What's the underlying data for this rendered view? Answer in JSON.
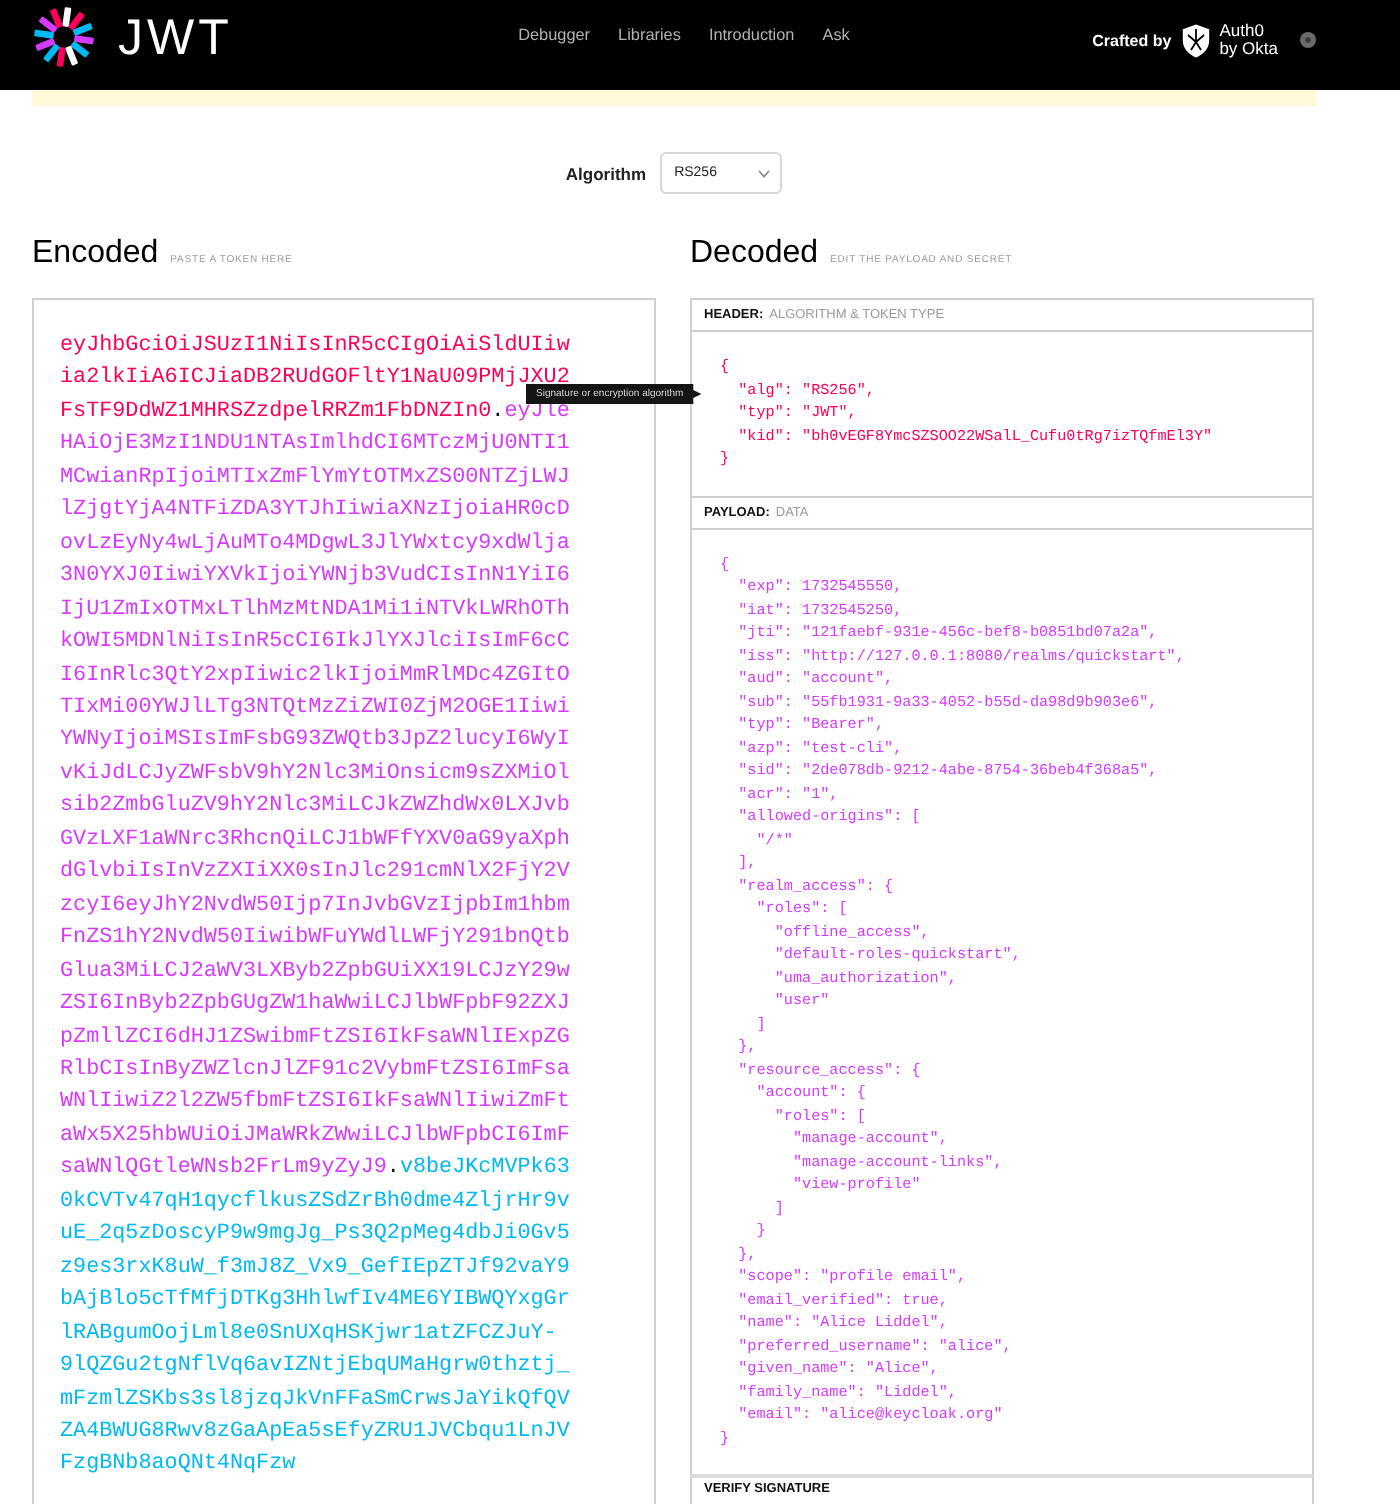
{
  "nav": {
    "logo_text": "JWT",
    "links": [
      "Debugger",
      "Libraries",
      "Introduction",
      "Ask"
    ],
    "credit_label": "Crafted by",
    "credit_brand": [
      "Auth0",
      "by Okta"
    ]
  },
  "algorithm": {
    "label": "Algorithm",
    "value": "RS256"
  },
  "tooltip": "Signature or encryption algorithm",
  "encoded": {
    "title": "Encoded",
    "hint": "PASTE A TOKEN HERE",
    "token_parts": [
      {
        "kind": "header",
        "text": "eyJhbGciOiJSUzI1NiIsInR5cCIgOiAiSldUIiwia2lkIiA6ICJiaDB2RUdGOFltY1NaU09PMjJXU2FsTF9DdWZ1MHRSZzdpelRRZm1FbDNZIn0"
      },
      {
        "kind": "separator",
        "text": "."
      },
      {
        "kind": "payload",
        "text": "eyJleHAiOjE3MzI1NDU1NTAsImlhdCI6MTczMjU0NTI1MCwianRpIjoiMTIxZmFlYmYtOTMxZS00NTZjLWJlZjgtYjA4NTFiZDA3YTJhIiwiaXNzIjoiaHR0cDovLzEyNy4wLjAuMTo4MDgwL3JlYWxtcy9xdWlja3N0YXJ0IiwiYXVkIjoiYWNjb3VudCIsInN1YiI6IjU1ZmIxOTMxLTlhMzMtNDA1Mi1iNTVkLWRhOThkOWI5MDNlNiIsInR5cCI6IkJlYXJlciIsImF6cCI6InRlc3QtY2xpIiwic2lkIjoiMmRlMDc4ZGItOTIxMi00YWJlLTg3NTQtMzZiZWI0ZjM2OGE1IiwiYWNyIjoiMSIsImFsbG93ZWQtb3JpZ2lucyI6WyIvKiJdLCJyZWFsbV9hY2Nlc3MiOnsicm9sZXMiOlsib2ZmbGluZV9hY2Nlc3MiLCJkZWZhdWx0LXJvbGVzLXF1aWNrc3RhcnQiLCJ1bWFfYXV0aG9yaXphdGlvbiIsInVzZXIiXX0sInJlc291cmNlX2FjY2VzcyI6eyJhY2NvdW50Ijp7InJvbGVzIjpbIm1hbmFnZS1hY2NvdW50IiwibWFuYWdlLWFjY291bnQtbGlua3MiLCJ2aWV3LXByb2ZpbGUiXX19LCJzY29wZSI6InByb2ZpbGUgZW1haWwiLCJlbWFpbF92ZXJpZmllZCI6dHJ1ZSwibmFtZSI6IkFsaWNlIExpZGRlbCIsInByZWZlcnJlZF91c2VybmFtZSI6ImFsaWNlIiwiZ2l2ZW5fbmFtZSI6IkFsaWNlIiwiZmFtaWx5X25hbWUiOiJMaWRkZWwiLCJlbWFpbCI6ImFsaWNlQGtleWNsb2FrLm9yZyJ9"
      },
      {
        "kind": "separator",
        "text": "."
      },
      {
        "kind": "signature",
        "text": "v8beJKcMVPk630kCVTv47qH1qycflkusZSdZrBh0dme4ZljrHr9vuE_2q5zDoscyP9w9mgJg_Ps3Q2pMeg4dbJi0Gv5z9es3rxK8uW_f3mJ8Z_Vx9_GefIEpZTJf92vaY9bAjBlo5cTfMfjDTKg3HhlwfIv4ME6YIBWQYxgGrlRABgumOojLml8e0SnUXqHSKjwr1atZFCZJuY-9lQZGu2tgNflVq6avIZNtjEbqUMaHgrw0thztj_mFzmlZSKbs3sl8jzqJkVnFFaSmCrwsJaYikQfQVZA4BWUG8Rwv8zGaApEa5sEfyZRU1JVCbqu1LnJVFzgBNb8aoQNt4NqFzw"
      }
    ]
  },
  "decoded": {
    "title": "Decoded",
    "hint": "EDIT THE PAYLOAD AND SECRET",
    "panels": [
      {
        "kind": "header",
        "title": "HEADER:",
        "subtitle": "ALGORITHM & TOKEN TYPE",
        "code": "{\n  \"alg\": \"RS256\",\n  \"typ\": \"JWT\",\n  \"kid\": \"bh0vEGF8YmcSZSOO22WSalL_Cufu0tRg7izTQfmEl3Y\"\n}"
      },
      {
        "kind": "payload",
        "title": "PAYLOAD:",
        "subtitle": "DATA",
        "code": "{\n  \"exp\": 1732545550,\n  \"iat\": 1732545250,\n  \"jti\": \"121faebf-931e-456c-bef8-b0851bd07a2a\",\n  \"iss\": \"http://127.0.0.1:8080/realms/quickstart\",\n  \"aud\": \"account\",\n  \"sub\": \"55fb1931-9a33-4052-b55d-da98d9b903e6\",\n  \"typ\": \"Bearer\",\n  \"azp\": \"test-cli\",\n  \"sid\": \"2de078db-9212-4abe-8754-36beb4f368a5\",\n  \"acr\": \"1\",\n  \"allowed-origins\": [\n    \"/*\"\n  ],\n  \"realm_access\": {\n    \"roles\": [\n      \"offline_access\",\n      \"default-roles-quickstart\",\n      \"uma_authorization\",\n      \"user\"\n    ]\n  },\n  \"resource_access\": {\n    \"account\": {\n      \"roles\": [\n        \"manage-account\",\n        \"manage-account-links\",\n        \"view-profile\"\n      ]\n    }\n  },\n  \"scope\": \"profile email\",\n  \"email_verified\": true,\n  \"name\": \"Alice Liddel\",\n  \"preferred_username\": \"alice\",\n  \"given_name\": \"Alice\",\n  \"family_name\": \"Liddel\",\n  \"email\": \"alice@keycloak.org\"\n}"
      },
      {
        "kind": "signature",
        "title": "VERIFY SIGNATURE"
      }
    ]
  }
}
